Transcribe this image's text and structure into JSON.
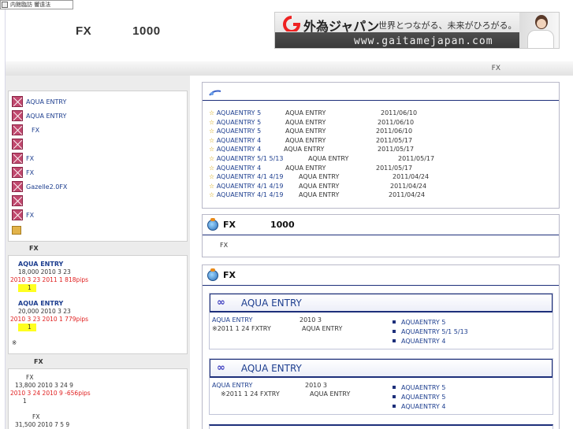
{
  "topbar": {
    "label": "内館臨訪 響遠法"
  },
  "header": {
    "title_left": "FX",
    "title_right": "1000"
  },
  "banner": {
    "brand": "外為ジャパン",
    "slogan": "世界とつながる、未来がひろがる。",
    "url": "www.gaitamejapan.com"
  },
  "band": {
    "label": "FX"
  },
  "sidebar": {
    "items": [
      {
        "label": "AQUA ENTRY",
        "icon": "x-icon"
      },
      {
        "label": "AQUA ENTRY",
        "icon": "x-icon"
      },
      {
        "label": "FX",
        "icon": "x-icon"
      },
      {
        "label": "",
        "icon": "x-icon"
      },
      {
        "label": "FX",
        "icon": "x-icon"
      },
      {
        "label": "FX",
        "icon": "x-icon"
      },
      {
        "label": "Gazelle2.0FX",
        "icon": "x-icon"
      },
      {
        "label": "",
        "icon": "x-icon"
      },
      {
        "label": "FX",
        "icon": "x-icon"
      },
      {
        "label": "",
        "icon": "folder-icon"
      }
    ],
    "section1": {
      "title": "FX",
      "records": [
        {
          "name": "AQUA ENTRY",
          "line1": "18,000  2010 3 23",
          "line2": "2010 3 23  2011 1     818pips",
          "rank": "1"
        },
        {
          "name": "AQUA ENTRY",
          "line1": "20,000  2010 3 23",
          "line2": "2010 3 23  2010 1     779pips",
          "rank": "1"
        }
      ],
      "note": "※"
    },
    "section2": {
      "title": "FX",
      "records": [
        {
          "name": "FX",
          "line1": "13,800  2010 3 24   9",
          "line2": "2010 3 24  2010 9   -656pips",
          "rank": "1"
        },
        {
          "name": "FX",
          "line1": "31,500  2010 7 5   9"
        }
      ]
    }
  },
  "news": {
    "rows": [
      {
        "link": "AQUAENTRY   5",
        "title": "AQUA ENTRY",
        "date": "2011/06/10"
      },
      {
        "link": "AQUAENTRY   5",
        "title": "AQUA ENTRY",
        "date": "2011/06/10"
      },
      {
        "link": "AQUAENTRY   5",
        "title": "AQUA ENTRY",
        "date": "2011/06/10"
      },
      {
        "link": "AQUAENTRY   4",
        "title": "AQUA ENTRY",
        "date": "2011/05/17"
      },
      {
        "link": "AQUAENTRY   4",
        "title": "AQUA ENTRY",
        "date": "2011/05/17"
      },
      {
        "link": "AQUAENTRY   5/1 5/13",
        "title": "AQUA ENTRY",
        "date": "2011/05/17"
      },
      {
        "link": "AQUAENTRY   4",
        "title": "AQUA ENTRY",
        "date": "2011/05/17"
      },
      {
        "link": "AQUAENTRY   4/1 4/19",
        "title": "AQUA ENTRY",
        "date": "2011/04/24"
      },
      {
        "link": "AQUAENTRY   4/1 4/19",
        "title": "AQUA ENTRY",
        "date": "2011/04/24"
      },
      {
        "link": "AQUAENTRY   4/1 4/19",
        "title": "AQUA ENTRY",
        "date": "2011/04/24"
      }
    ]
  },
  "panel2": {
    "title_left": "FX",
    "title_right": "1000",
    "body": "FX"
  },
  "panel3": {
    "title": "FX",
    "cards": [
      {
        "heading": "AQUA ENTRY",
        "left1": "AQUA ENTRY",
        "left1b": "2010 3",
        "left2": "※2011 1 24   FXTRY",
        "left2b": "AQUA ENTRY",
        "links": [
          "AQUAENTRY   5",
          "AQUAENTRY   5/1 5/13",
          "AQUAENTRY   4"
        ]
      },
      {
        "heading": "AQUA ENTRY",
        "left1": "AQUA ENTRY",
        "left1b": "2010 3",
        "left2": "※2011 1 24   FXTRY",
        "left2b": "AQUA ENTRY",
        "links": [
          "AQUAENTRY   5",
          "AQUAENTRY   5",
          "AQUAENTRY   4"
        ]
      }
    ]
  },
  "colors": {
    "accent": "#1d2f7a",
    "link": "#1d3e8f",
    "loss_red": "#e02020",
    "highlight": "#ffff20"
  }
}
